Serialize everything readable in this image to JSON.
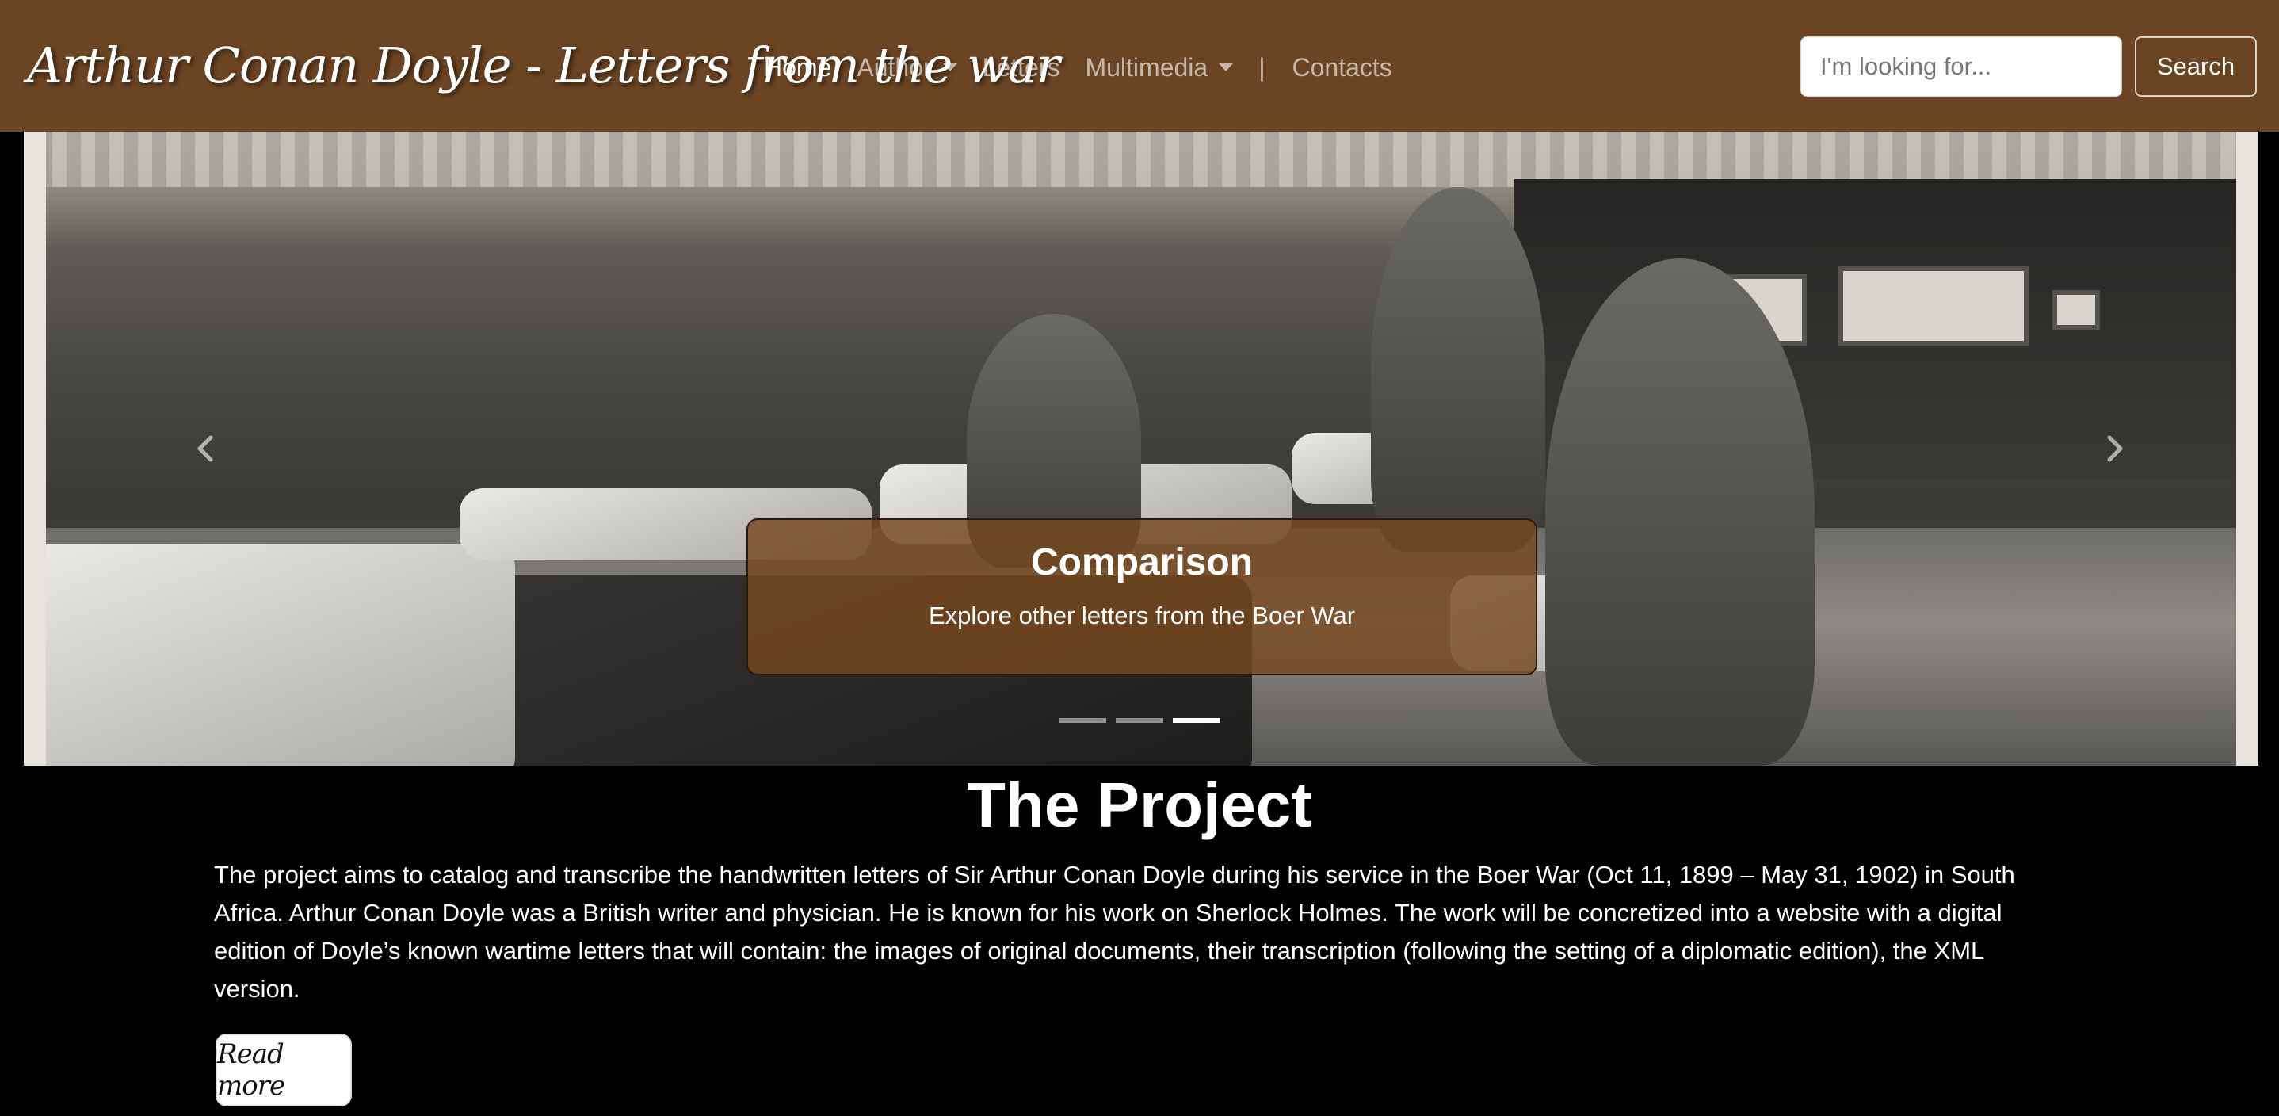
{
  "brand": "Arthur Conan Doyle - Letters from the war",
  "nav": {
    "home": "Home",
    "author": "Author",
    "letters": "Letters",
    "multimedia": "Multimedia",
    "separator": "|",
    "contacts": "Contacts"
  },
  "search": {
    "placeholder": "I'm looking for...",
    "button": "Search"
  },
  "carousel": {
    "caption_title": "Comparison",
    "caption_text": "Explore other letters from the Boer War",
    "slide_count": 3,
    "active_slide": 3
  },
  "project": {
    "title": "The Project",
    "text": "The project aims to catalog and transcribe the handwritten letters of Sir Arthur Conan Doyle during his service in the Boer War (Oct 11, 1899 – May 31, 1902) in South Africa. Arthur Conan Doyle was a British writer and physician. He is known for his work on Sherlock Holmes. The work will be concretized into a website with a digital edition of Doyle’s known wartime letters that will contain: the images of original documents, their transcription (following the setting of a diplomatic edition), the XML version.",
    "read_more": "Read more"
  },
  "colors": {
    "navbar": "#6b4423",
    "caption_bg": "#78481e",
    "page_bg": "#000000"
  }
}
